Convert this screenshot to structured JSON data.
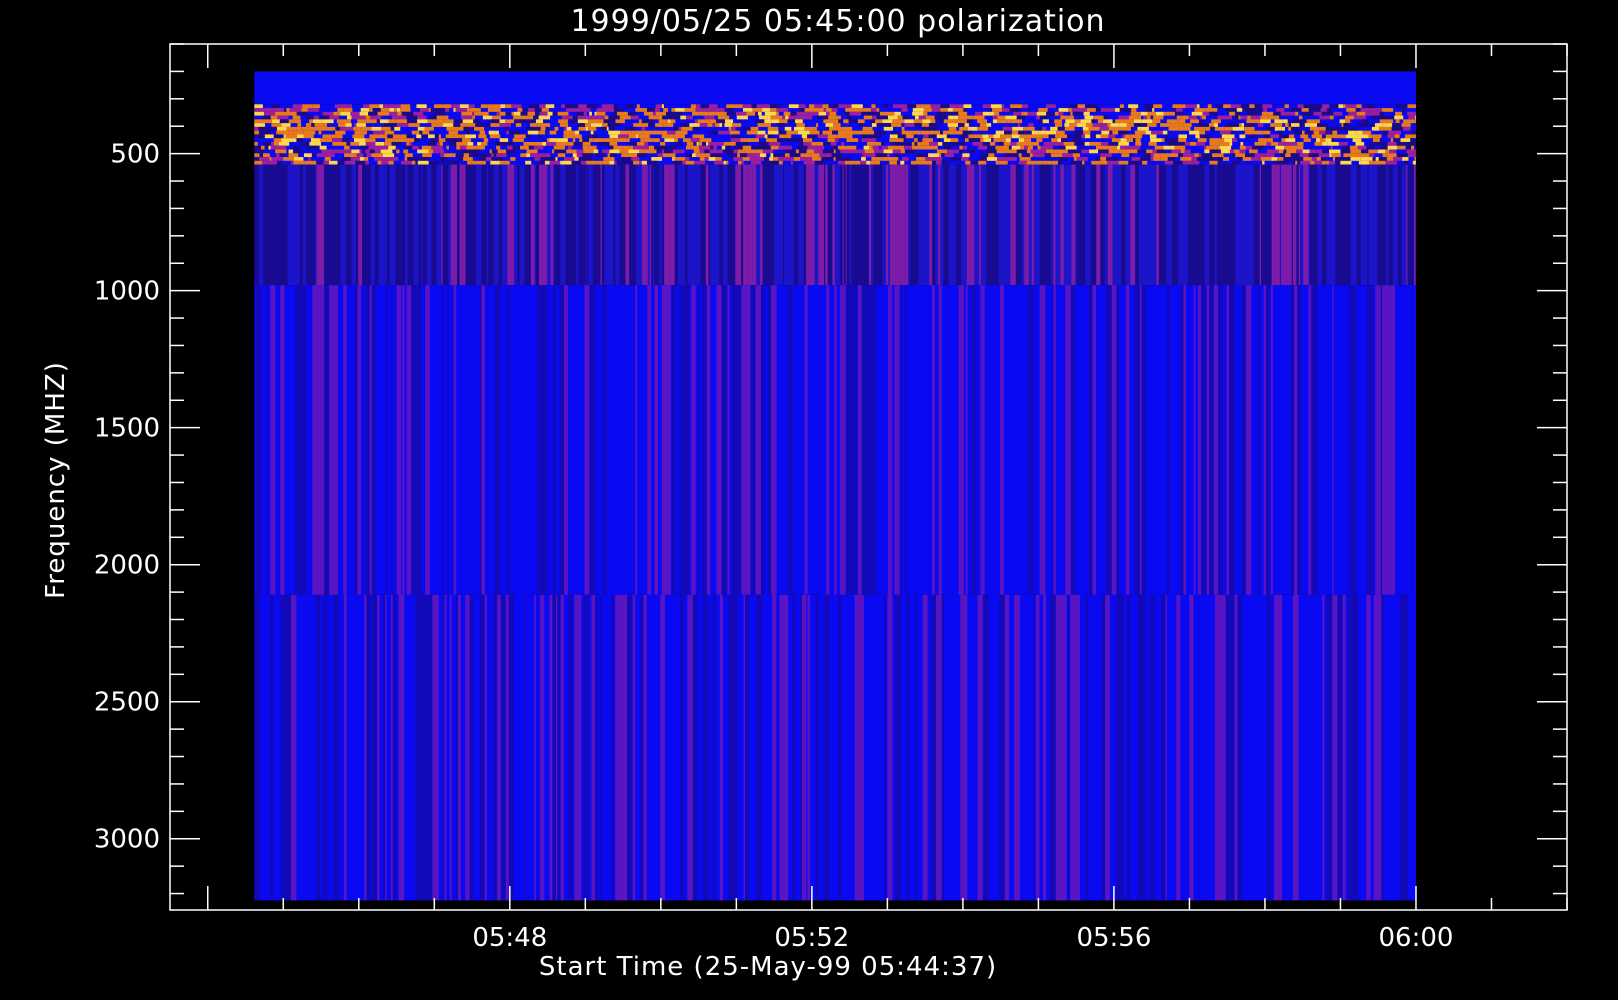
{
  "chart_data": {
    "type": "heatmap",
    "title": "1999/05/25 05:45:00 polarization",
    "xlabel": "Start Time (25-May-99 05:44:37)",
    "ylabel": "Frequency (MHZ)",
    "x_unit": "minutes",
    "xlim": [
      "05:43:30",
      "06:02:00"
    ],
    "ylim": [
      3260,
      100
    ],
    "y_inverted": true,
    "x_major_ticks": [
      "05:48",
      "05:52",
      "05:56",
      "06:00"
    ],
    "y_major_ticks": [
      500,
      1000,
      1500,
      2000,
      2500,
      3000
    ],
    "data_extent": {
      "x_start": "05:44:37",
      "x_end": "06:00:00",
      "y_top": 200,
      "y_bottom": 3225
    },
    "bands": [
      {
        "freq_from": 200,
        "freq_to": 320,
        "appearance": "uniform"
      },
      {
        "freq_from": 320,
        "freq_to": 540,
        "appearance": "intense-mixed"
      },
      {
        "freq_from": 540,
        "freq_to": 980,
        "appearance": "dark-striped"
      },
      {
        "freq_from": 980,
        "freq_to": 2110,
        "appearance": "striped"
      },
      {
        "freq_from": 2110,
        "freq_to": 3225,
        "appearance": "striped"
      }
    ],
    "colors": {
      "background": "#000000",
      "foreground": "#ffffff",
      "base": "#0a0af2",
      "dark": "#1a0a8a",
      "red": "#9c1f9c",
      "orange": "#e87a1a",
      "yellow": "#ffd84a"
    },
    "grid": false,
    "legend": "none"
  }
}
